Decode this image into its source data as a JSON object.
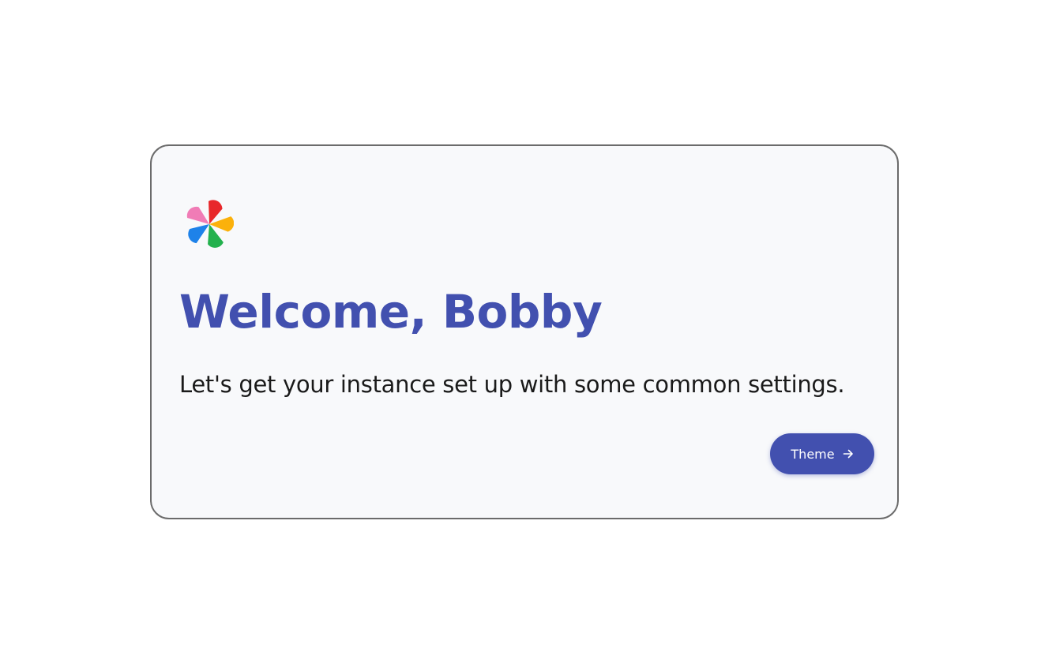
{
  "welcome": {
    "title": "Welcome, Bobby",
    "subtitle": "Let's get your instance set up with some common settings."
  },
  "actions": {
    "next_label": "Theme",
    "next_icon": "arrow-right-icon"
  },
  "logo": {
    "icon": "app-logo-icon",
    "colors": [
      "#e8282b",
      "#fbb10b",
      "#23b14d",
      "#1e82e9",
      "#f07cb6"
    ]
  },
  "colors": {
    "accent": "#4250af",
    "card_background": "#f8f9fb",
    "card_border": "#6b6b6b"
  }
}
